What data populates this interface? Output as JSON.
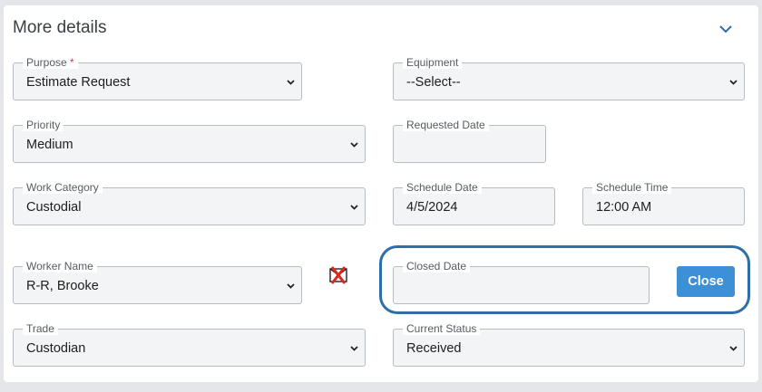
{
  "section": {
    "title": "More details"
  },
  "fields": {
    "purpose": {
      "label": "Purpose",
      "required_mark": "*",
      "value": "Estimate Request"
    },
    "equipment": {
      "label": "Equipment",
      "value": "--Select--"
    },
    "priority": {
      "label": "Priority",
      "value": "Medium"
    },
    "requested_date": {
      "label": "Requested Date",
      "value": ""
    },
    "work_category": {
      "label": "Work Category",
      "value": "Custodial"
    },
    "schedule_date": {
      "label": "Schedule Date",
      "value": "4/5/2024"
    },
    "schedule_time": {
      "label": "Schedule Time",
      "value": "12:00 AM"
    },
    "worker_name": {
      "label": "Worker Name",
      "value": "R-R, Brooke"
    },
    "closed_date": {
      "label": "Closed Date",
      "value": ""
    },
    "trade": {
      "label": "Trade",
      "value": "Custodian"
    },
    "current_status": {
      "label": "Current Status",
      "value": "Received"
    }
  },
  "buttons": {
    "close_label": "Close"
  },
  "icons": {
    "collapse": "chevron-down-icon",
    "remove_worker": "delete-x-icon"
  },
  "colors": {
    "accent": "#3d8fd6",
    "highlight_ring": "#2e6fa7",
    "required": "#dd3333"
  }
}
